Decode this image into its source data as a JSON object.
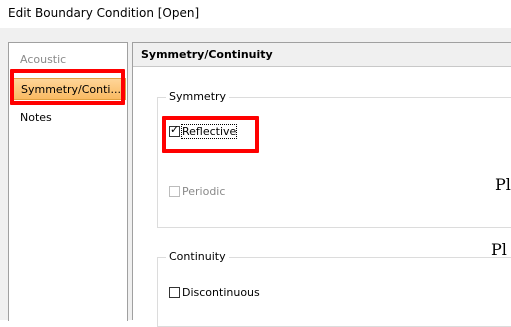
{
  "window": {
    "title": "Edit Boundary Condition [Open]"
  },
  "nav": {
    "items": [
      {
        "label": "Acoustic",
        "state": "disabled"
      },
      {
        "label": "Symmetry/Conti...",
        "state": "selected"
      },
      {
        "label": "Notes",
        "state": "normal"
      }
    ],
    "highlight_color": "#ff0000",
    "selected_color": "#f9ba62"
  },
  "content": {
    "header": "Symmetry/Continuity",
    "symmetry_group": {
      "legend": "Symmetry",
      "reflective": {
        "label": "Reflective",
        "checked": true
      },
      "periodic": {
        "label": "Periodic",
        "checked": false,
        "enabled": false
      }
    },
    "continuity_group": {
      "legend": "Continuity",
      "discontinuous": {
        "label": "Discontinuous",
        "checked": false
      }
    }
  },
  "overlay": {
    "text_1": "Pl",
    "text_2": "Pl"
  }
}
